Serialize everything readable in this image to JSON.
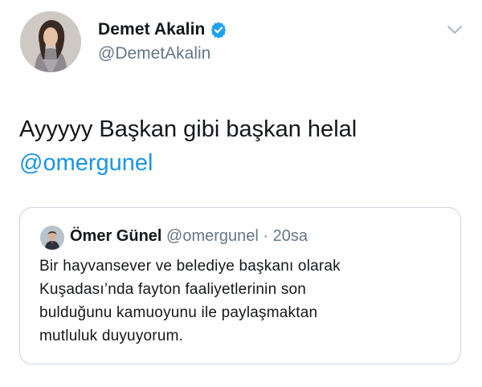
{
  "author": {
    "display_name": "Demet Akalin",
    "handle": "@DemetAkalin",
    "verified": true,
    "avatar_icon": "profile-photo"
  },
  "menu": {
    "icon": "chevron-down-icon"
  },
  "tweet": {
    "lines": [
      "Ayyyyy Başkan gibi başkan helal"
    ],
    "mention": "@omergunel"
  },
  "quoted_tweet": {
    "display_name": "Ömer Günel",
    "handle": "@omergunel",
    "separator": "·",
    "time": "20sa",
    "avatar_icon": "profile-photo",
    "lines": [
      "Bir hayvansever ve belediye başkanı olarak",
      "Kuşadası’nda fayton faaliyetlerinin son",
      "bulduğunu kamuoyunu ile paylaşmaktan",
      "mutluluk duyuyorum."
    ]
  },
  "colors": {
    "text": "#14171a",
    "secondary": "#657786",
    "link": "#1b95e0",
    "verified": "#1da1f2",
    "border": "#ccd6dd"
  }
}
